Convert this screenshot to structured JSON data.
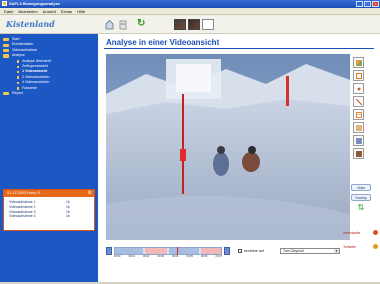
{
  "window": {
    "title": "SAFI-3 Bewegungsanalyse",
    "buttons": [
      "_",
      "□",
      "×"
    ]
  },
  "menu": [
    "Datei",
    "Bearbeiten",
    "Ansicht",
    "Extras",
    "Hilfe"
  ],
  "logo": {
    "text": "Kistenland"
  },
  "toolbar": {
    "refresh_glyph": "↻"
  },
  "sidebar": {
    "items": [
      {
        "label": "Start",
        "level": 0
      },
      {
        "label": "Kundendaten",
        "level": 0
      },
      {
        "label": "Videoaufnahme",
        "level": 0
      },
      {
        "label": "Analyse",
        "level": 0
      },
      {
        "label": "Analyse Übersicht",
        "level": 1
      },
      {
        "label": "Zeitlupenansicht",
        "level": 1
      },
      {
        "label": "1 Videoansicht",
        "level": 1,
        "active": true
      },
      {
        "label": "2 Videoansichten",
        "level": 1
      },
      {
        "label": "4 Videoansichten",
        "level": 1
      },
      {
        "label": "Fotoserie",
        "level": 1
      },
      {
        "label": "Report",
        "level": 0
      }
    ],
    "panel": {
      "title": "01.12.2003 Harry S.",
      "rows": [
        {
          "label": "Videoaufnahme 1",
          "value": "1b"
        },
        {
          "label": "Videoaufnahme 2",
          "value": "1b"
        },
        {
          "label": "Videoaufnahme 3",
          "value": "1b"
        },
        {
          "label": "Videoaufnahme 4",
          "value": "1b"
        }
      ]
    }
  },
  "main": {
    "title": "Analyse in einer Videoansicht",
    "side_buttons": {
      "video": "Video",
      "overlay": "Overlay"
    },
    "timeline": {
      "labels": [
        "00:00",
        "00:01",
        "00:02",
        "00:03",
        "00:04",
        "00:05",
        "00:06",
        "00:07"
      ]
    },
    "controls": {
      "checkbox_label": "zentriere auf",
      "select_value": "Tom Gleynsdl"
    },
    "legend": [
      {
        "label": "Innenkante",
        "color": "#d9541a"
      },
      {
        "label": "Torfarbe",
        "color": "#d9541a"
      }
    ]
  },
  "colors": {
    "accent": "#1c58c4",
    "panel_header": "#e46a19",
    "timeline_red": "#dd2222"
  }
}
